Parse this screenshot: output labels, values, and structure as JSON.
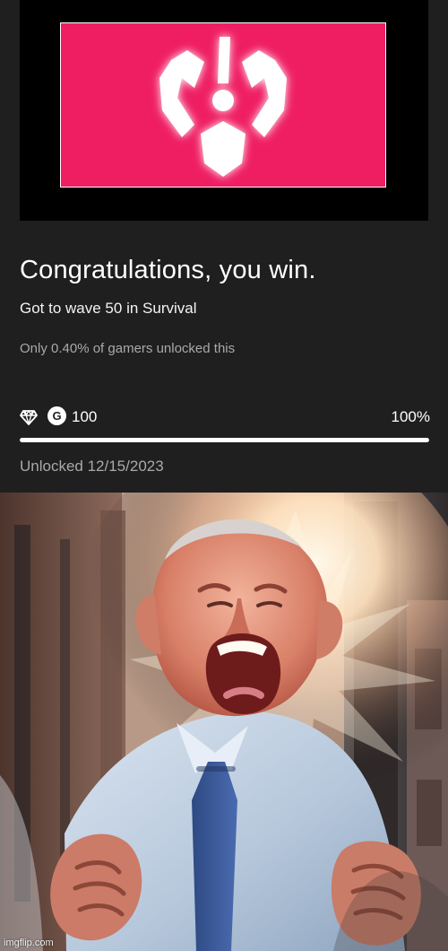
{
  "achievement": {
    "title": "Congratulations, you win.",
    "description": "Got to wave 50 in Survival",
    "rarity_text": "Only 0.40% of gamers unlocked this",
    "gamerscore_badge": "G",
    "gamerscore_value": "100",
    "progress_text": "100%",
    "progress_value": 100,
    "unlocked_text": "Unlocked 12/15/2023",
    "card_color": "#ef1e63",
    "icons": {
      "reward": "diamond-icon",
      "score": "gamerscore-icon",
      "emblem": "exclamation-emblem-icon"
    }
  },
  "meme_image": {
    "watermark": "imgflip.com"
  }
}
